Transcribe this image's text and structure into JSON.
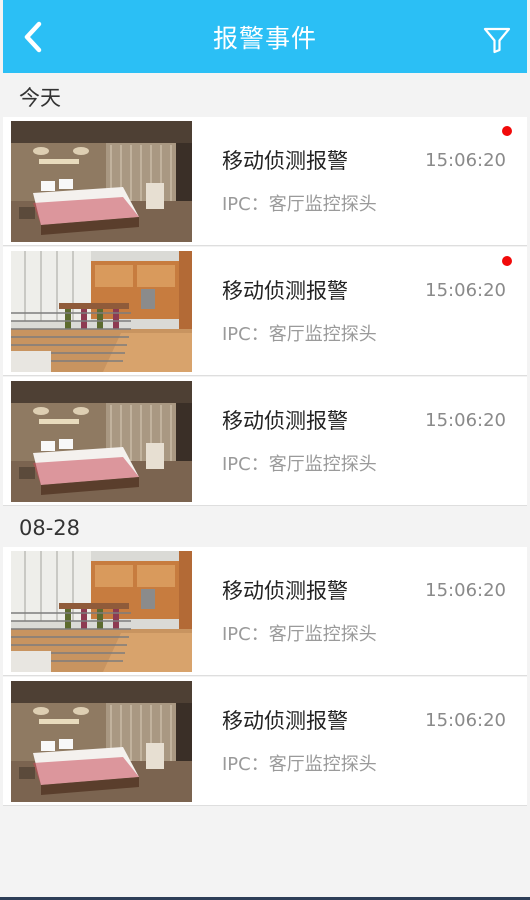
{
  "header": {
    "title": "报警事件",
    "back_icon": "chevron-left-icon",
    "filter_icon": "filter-icon",
    "color": "#2bbff5"
  },
  "sections": [
    {
      "label": "今天",
      "items": [
        {
          "title": "移动侦测报警",
          "time": "15:06:20",
          "source": "IPC：客厅监控探头",
          "unread": true,
          "image": "bedroom"
        },
        {
          "title": "移动侦测报警",
          "time": "15:06:20",
          "source": "IPC：客厅监控探头",
          "unread": true,
          "image": "loft"
        },
        {
          "title": "移动侦测报警",
          "time": "15:06:20",
          "source": "IPC：客厅监控探头",
          "unread": false,
          "image": "bedroom"
        }
      ]
    },
    {
      "label": "08-28",
      "items": [
        {
          "title": "移动侦测报警",
          "time": "15:06:20",
          "source": "IPC：客厅监控探头",
          "unread": false,
          "image": "loft"
        },
        {
          "title": "移动侦测报警",
          "time": "15:06:20",
          "source": "IPC：客厅监控探头",
          "unread": false,
          "image": "bedroom"
        }
      ]
    }
  ],
  "colors": {
    "unread_dot": "#f10a0a"
  }
}
